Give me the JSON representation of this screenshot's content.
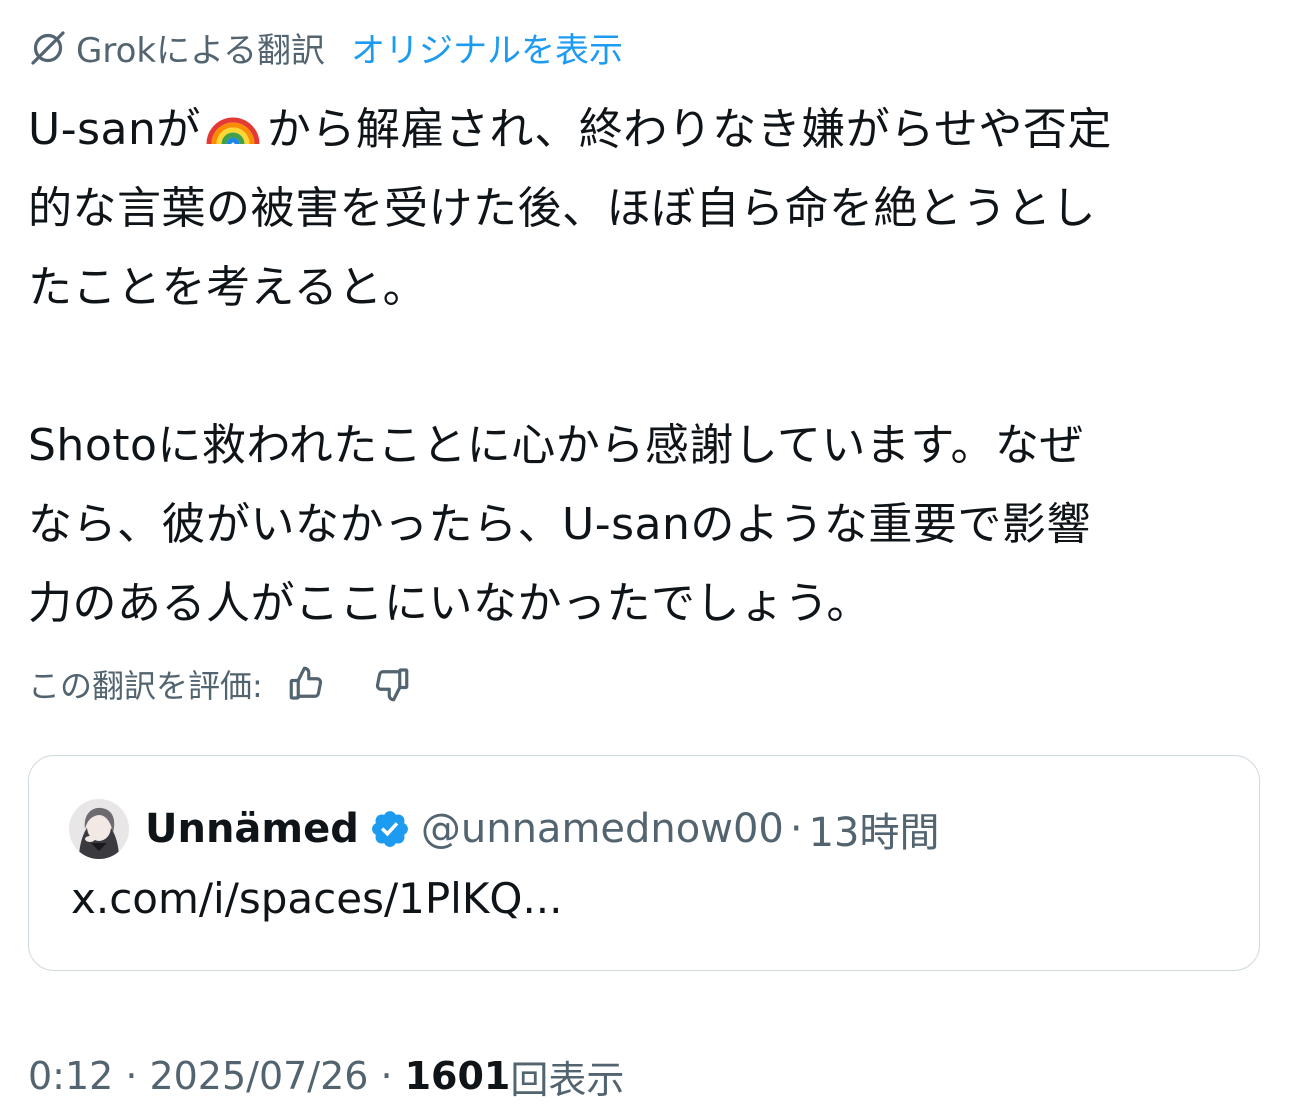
{
  "translation": {
    "grok_label": "Grokによる翻訳",
    "show_original": "オリジナルを表示",
    "icon": "grok-icon"
  },
  "tweet": {
    "line1_before": "U-sanが",
    "line1_emoji": "rainbow",
    "line1_after": "から解雇され、終わりなき嫌がらせや否定",
    "line2": "的な言葉の被害を受けた後、ほぼ自ら命を絶とうとし",
    "line3": "たことを考えると。",
    "line4": "Shotoに救われたことに心から感謝しています。なぜ",
    "line5": "なら、彼がいなかったら、U-sanのような重要で影響",
    "line6": "力のある人がここにいなかったでしょう。"
  },
  "rating": {
    "label": "この翻訳を評価:",
    "up_icon": "thumbs-up-icon",
    "down_icon": "thumbs-down-icon"
  },
  "quote": {
    "display_name": "Unnämed",
    "verified": true,
    "verified_color": "#1d9bf0",
    "handle": "@unnamednow00",
    "separator": "·",
    "time": "13時間",
    "text": "x.com/i/spaces/1PlKQ..."
  },
  "meta": {
    "time": "0:12",
    "separator": "·",
    "date": "2025/07/26",
    "views_count": "1601",
    "views_label": "回表示"
  },
  "colors": {
    "text": "#0f1419",
    "secondary": "#536471",
    "link": "#1d9bf0",
    "border": "#cfd9de"
  }
}
